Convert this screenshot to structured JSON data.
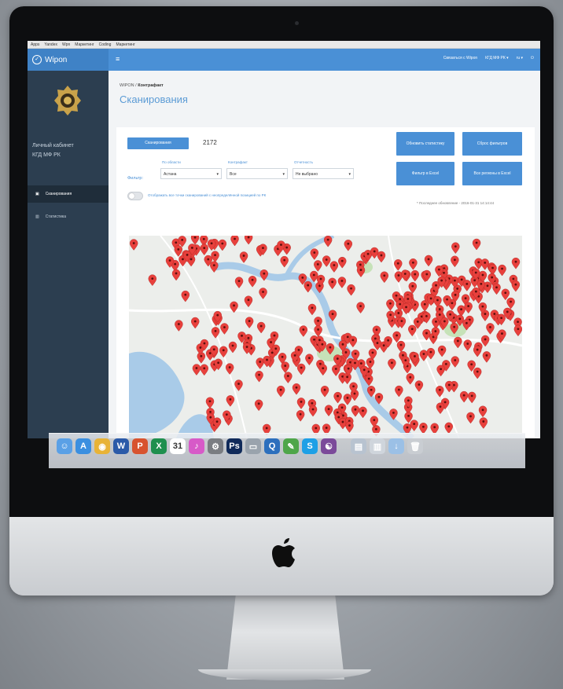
{
  "bookmarks": [
    "Apps",
    "Yandex",
    "Wpn",
    "Маркетинг",
    "Coding",
    "Маркетинг"
  ],
  "app": {
    "brand": "Wipon",
    "menu_icon": "≡"
  },
  "topbar": {
    "user_link": "Связаться с Wipon",
    "account": "КГД МФ РК ▾",
    "lang": "ru ▾",
    "power": "⏻"
  },
  "sidebar": {
    "cabinet_line1": "Личный кабинет",
    "cabinet_line2": "КГД МФ РК",
    "items": [
      {
        "label": "Сканирования",
        "icon": "scan-icon",
        "active": true
      },
      {
        "label": "Статистика",
        "icon": "chart-icon",
        "active": false
      }
    ]
  },
  "breadcrumb": {
    "root": "WIPON",
    "sep": "/",
    "current": "Контрафакт"
  },
  "page_title": "Сканирования",
  "toolbar": {
    "scans_button": "Сканирования",
    "count": "2172",
    "refresh_stats": "Обновить статистику",
    "reset_filters": "Сброс фильтров",
    "filter_excel": "Фильтр в Excel",
    "all_regions_excel": "Все регионы в Excel"
  },
  "filters": {
    "label": "Фильтр:",
    "region": {
      "caption": "По области",
      "value": "Астана"
    },
    "counterfeit": {
      "caption": "Контрафакт",
      "value": "Все"
    },
    "reporting": {
      "caption": "Отчетность",
      "value": "Не выбрано"
    }
  },
  "toggle_label": "Отображать все точки сканирований с неопределённой позицией по РК",
  "updated": "* Последнее обновление - 2016-01-31 14:14:44",
  "colors": {
    "accent": "#4a90d6",
    "sidebar": "#2c3e50",
    "pin": "#e8403c"
  },
  "dock": {
    "icons": [
      "finder-icon",
      "app-store-icon",
      "chrome-icon",
      "word-icon",
      "powerpoint-icon",
      "excel-icon",
      "calendar-icon",
      "itunes-icon",
      "preferences-icon",
      "photoshop-icon",
      "preview-icon",
      "quicktime-icon",
      "evernote-icon",
      "skype-icon",
      "github-icon",
      "folder-icon",
      "document-icon",
      "downloads-icon",
      "trash-icon"
    ],
    "calendar_day": "31"
  }
}
